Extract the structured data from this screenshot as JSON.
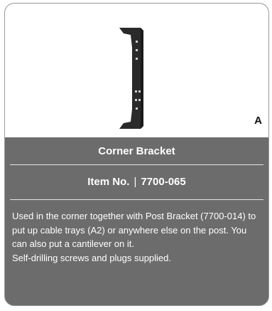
{
  "product": {
    "variant": "A",
    "title": "Corner Bracket",
    "item_label": "Item No.",
    "item_separator": "|",
    "item_number": "7700-065",
    "description": "Used in the corner together with Post Bracket (7700-014) to put up cable trays (A2) or anywhere else on the post. You can also put a cantilever on it.",
    "note": "Self-drilling screws and plugs supplied."
  },
  "colors": {
    "panel_background": "#6c6c6c",
    "image_background": "#ffffff",
    "text": "#ffffff",
    "bracket": "#2a2a2a"
  }
}
